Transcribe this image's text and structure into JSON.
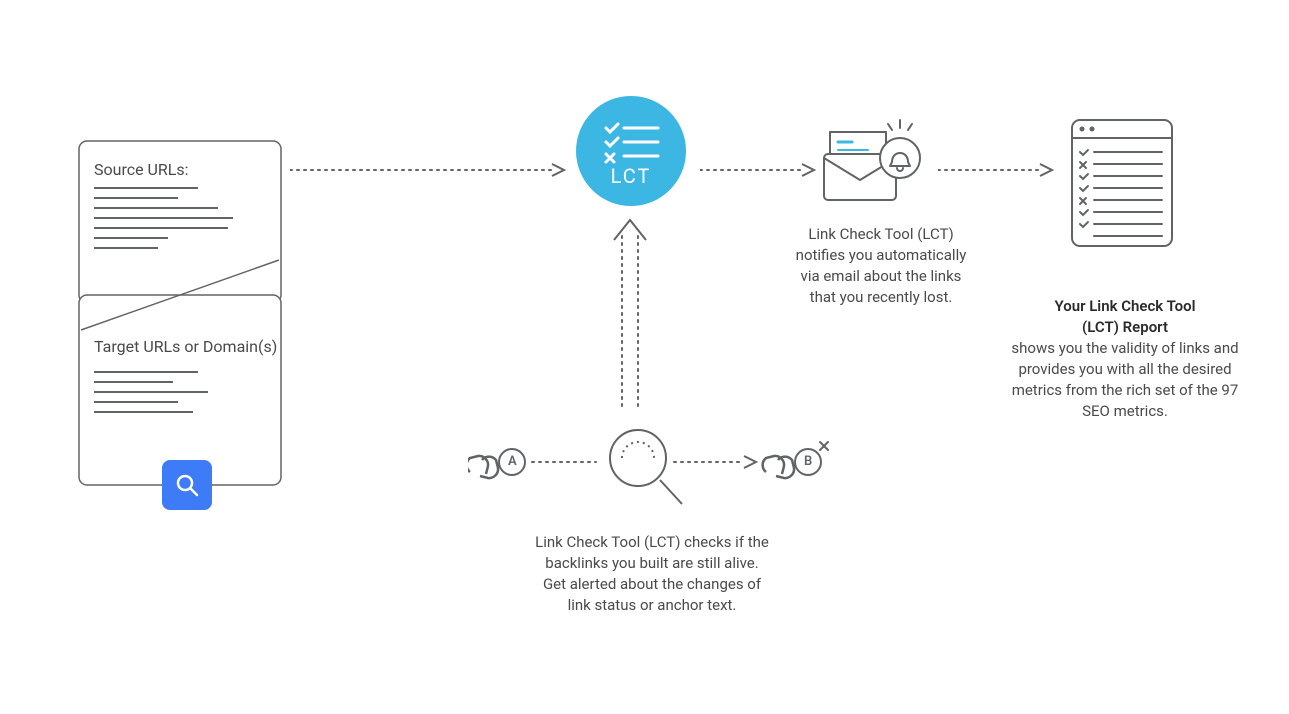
{
  "input_card": {
    "source_label": "Source URLs:",
    "target_label": "Target URLs or Domain(s)"
  },
  "lct_badge": {
    "text": "LCT"
  },
  "check_block": {
    "a": "A",
    "b": "B",
    "caption_l1": "Link Check Tool (LCT) checks if the",
    "caption_l2": "backlinks you built are still alive.",
    "caption_l3": "Get alerted about the changes of",
    "caption_l4": "link status or anchor text."
  },
  "notify_block": {
    "caption_l1": "Link Check Tool (LCT)",
    "caption_l2": "notifies you automatically",
    "caption_l3": "via email about the links",
    "caption_l4": "that you recently lost."
  },
  "report_block": {
    "title_l1": "Your Link Check Tool",
    "title_l2": "(LCT) Report",
    "caption_l1": "shows you the validity of links and",
    "caption_l2": "provides you with all the desired",
    "caption_l3": "metrics from the rich set of the 97",
    "caption_l4": "SEO metrics."
  }
}
